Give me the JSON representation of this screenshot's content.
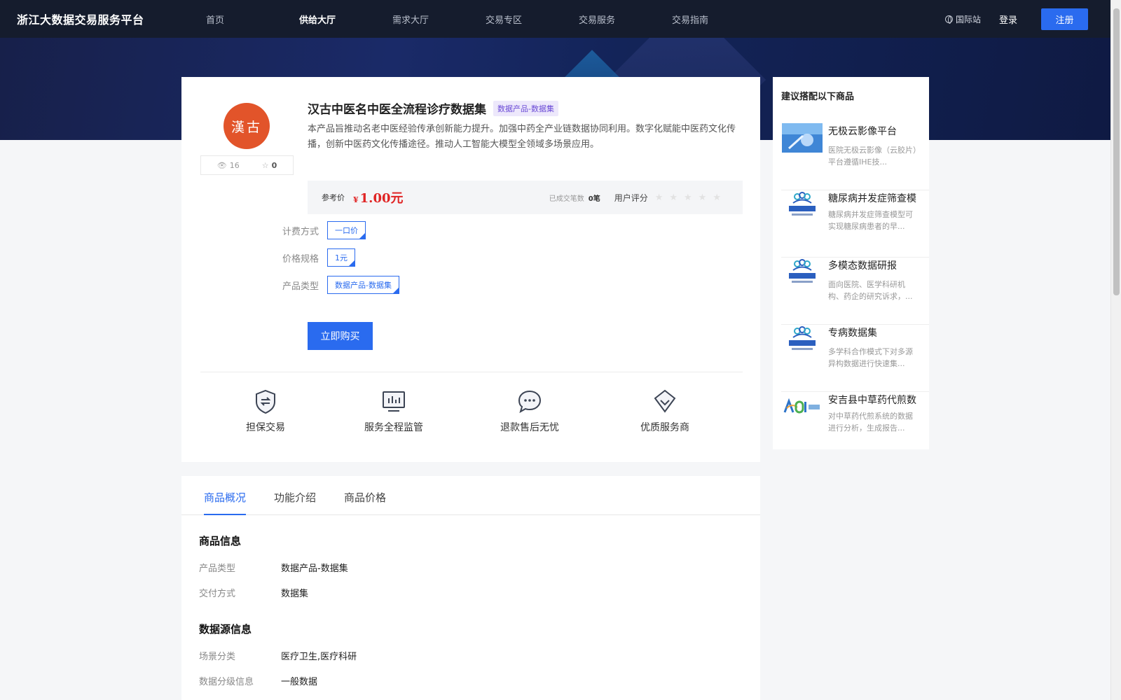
{
  "header": {
    "logo": "浙江大数据交易服务平台",
    "nav": [
      "首页",
      "供给大厅",
      "需求大厅",
      "交易专区",
      "交易服务",
      "交易指南"
    ],
    "intl": "国际站",
    "login": "登录",
    "register": "注册"
  },
  "product": {
    "avatar_text": "漢古",
    "views": "16",
    "favorites": "0",
    "title": "汉古中医名中医全流程诊疗数据集",
    "tag": "数据产品-数据集",
    "description": "本产品旨推动名老中医经验传承创新能力提升。加强中药全产业链数据协同利用。数字化赋能中医药文化传播，创新中医药文化传播途径。推动人工智能大模型全领域多场景应用。",
    "price_label": "参考价",
    "currency": "¥",
    "price": "1.00元",
    "deals_label": "已成交笔数",
    "deals": "0笔",
    "rating_label": "用户评分",
    "rating": 0,
    "specs": [
      {
        "key": "计费方式",
        "value": "一口价"
      },
      {
        "key": "价格规格",
        "value": "1元"
      },
      {
        "key": "产品类型",
        "value": "数据产品-数据集"
      }
    ],
    "buy_label": "立即购买",
    "features": [
      {
        "icon": "shield-exchange-icon",
        "label": "担保交易"
      },
      {
        "icon": "monitor-chart-icon",
        "label": "服务全程监管"
      },
      {
        "icon": "chat-bubble-icon",
        "label": "退款售后无忧"
      },
      {
        "icon": "diamond-icon",
        "label": "优质服务商"
      }
    ]
  },
  "tabs": [
    "商品概况",
    "功能介绍",
    "商品价格"
  ],
  "overview": {
    "sections": [
      {
        "title": "商品信息",
        "rows": [
          {
            "key": "产品类型",
            "value": "数据产品-数据集"
          },
          {
            "key": "交付方式",
            "value": "数据集"
          }
        ]
      },
      {
        "title": "数据源信息",
        "rows": [
          {
            "key": "场景分类",
            "value": "医疗卫生,医疗科研"
          },
          {
            "key": "数据分级信息",
            "value": "一般数据"
          }
        ]
      }
    ]
  },
  "sidebar": {
    "title": "建议搭配以下商品",
    "items": [
      {
        "name": "无极云影像平台",
        "desc": "医院无极云影像（云胶片）平台遵循IHE技...",
        "thumb": "medical-imaging-thumb"
      },
      {
        "name": "糖尿病并发症筛查模",
        "desc": "糖尿病并发症筛查模型可实现糖尿病患者的早...",
        "thumb": "ningtang-health-logo"
      },
      {
        "name": "多模态数据研报",
        "desc": "面向医院、医学科研机构、药企的研究诉求，...",
        "thumb": "ningtang-health-logo"
      },
      {
        "name": "专病数据集",
        "desc": "多学科合作模式下对多源异构数据进行快速集...",
        "thumb": "ningtang-health-logo"
      },
      {
        "name": "安吉县中草药代煎数",
        "desc": "对中草药代煎系统的数据进行分析，生成报告...",
        "thumb": "adi-logo"
      }
    ]
  },
  "colors": {
    "accent": "#2a6bef",
    "price": "#e02424",
    "header_bg": "#151c2d"
  }
}
